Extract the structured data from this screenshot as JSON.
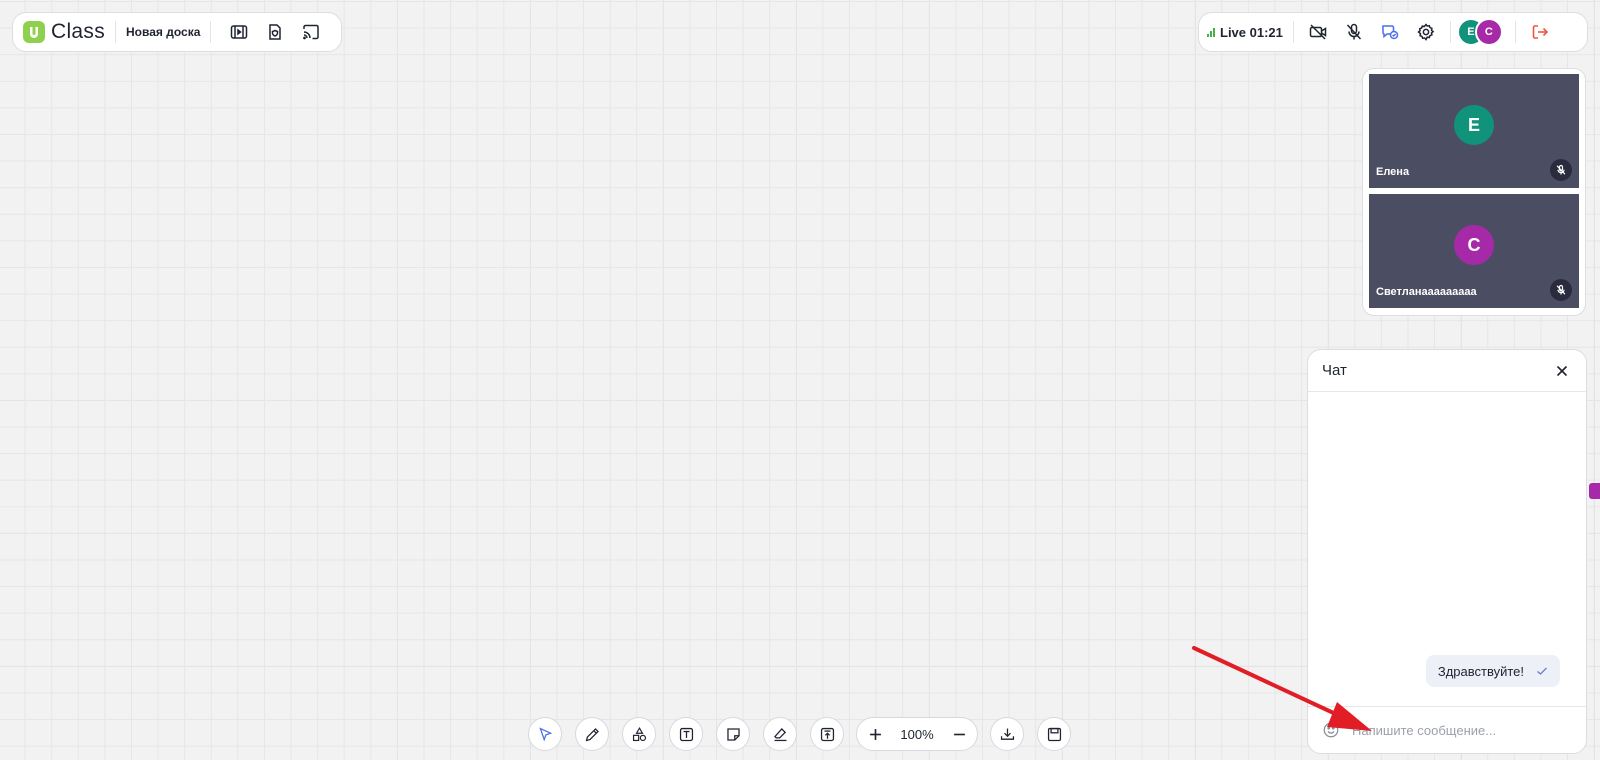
{
  "app": {
    "logo_text": "Class",
    "board_name": "Новая доска"
  },
  "session": {
    "live_label": "Live 01:21"
  },
  "participants": [
    {
      "initial": "Е",
      "name": "Елена",
      "color": "#10937a"
    },
    {
      "initial": "С",
      "name": "Светланааааааааа",
      "color": "#a62aa8"
    }
  ],
  "chat": {
    "title": "Чат",
    "messages": [
      {
        "text": "Здравствуйте!"
      }
    ],
    "input_placeholder": "Напишите сообщение..."
  },
  "toolbar": {
    "zoom_level": "100%"
  },
  "colors": {
    "accent": "#8fd14f",
    "leave": "#e8573f",
    "chat_active": "#4f6ee8"
  }
}
